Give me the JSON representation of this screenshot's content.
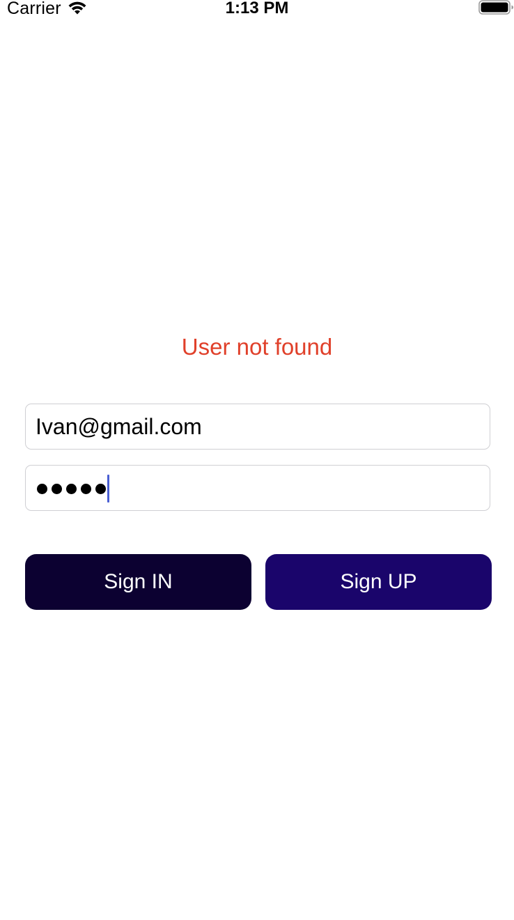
{
  "status_bar": {
    "carrier": "Carrier",
    "time": "1:13 PM",
    "wifi_icon": "wifi-icon",
    "battery_icon": "battery-full-icon"
  },
  "error": {
    "message": "User not found",
    "color": "#e0402a"
  },
  "login_form": {
    "email_value": "Ivan@gmail.com",
    "password_masked_length": 5,
    "password_masked": "•••••",
    "caret_color": "#4a5fd3"
  },
  "buttons": {
    "sign_in_label": "Sign IN",
    "sign_in_color": "#0c0131",
    "sign_up_label": "Sign UP",
    "sign_up_color": "#1a056b"
  }
}
